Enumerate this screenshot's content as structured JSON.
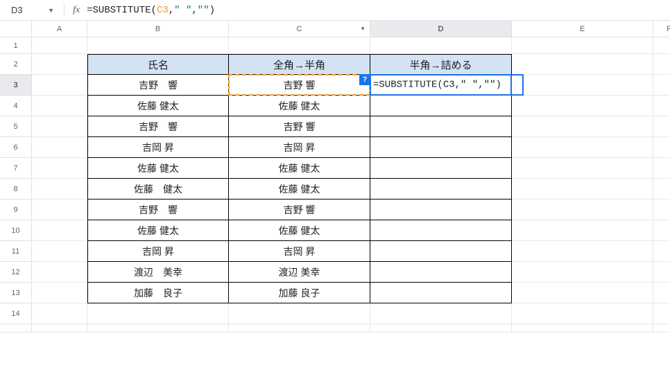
{
  "name_box": "D3",
  "formula_bar": {
    "prefix": "=",
    "fn": "SUBSTITUTE",
    "open": "(",
    "ref": "C3",
    "c1": ",",
    "s1": "\" \"",
    "c2": ",",
    "s2": "\"\"",
    "close": ")"
  },
  "cell_formula": {
    "prefix": "=",
    "fn": "SUBSTITUTE",
    "open": "(",
    "ref": "C3",
    "c1": ",",
    "s1": "\" \"",
    "c2": ",",
    "s2": "\"\"",
    "close": ")"
  },
  "columns": [
    "A",
    "B",
    "C",
    "D",
    "E",
    "F"
  ],
  "col_widths": {
    "A": 80,
    "B": 204,
    "C": 204,
    "D": 204,
    "E": 204,
    "F": 46
  },
  "active_col": "D",
  "row_count": 15,
  "row_height_default": 30,
  "row_height_first": 24,
  "active_row": 3,
  "table": {
    "headers": {
      "B": "氏名",
      "C": "全角→半角",
      "D": "半角→詰める"
    },
    "rows": [
      {
        "B": "吉野　響",
        "C": "吉野 響"
      },
      {
        "B": "佐藤 健太",
        "C": "佐藤 健太"
      },
      {
        "B": "吉野　響",
        "C": "吉野 響"
      },
      {
        "B": "吉岡 昇",
        "C": "吉岡 昇"
      },
      {
        "B": "佐藤 健太",
        "C": "佐藤 健太"
      },
      {
        "B": "佐藤　健太",
        "C": "佐藤 健太"
      },
      {
        "B": "吉野　響",
        "C": "吉野 響"
      },
      {
        "B": "佐藤 健太",
        "C": "佐藤 健太"
      },
      {
        "B": "吉岡 昇",
        "C": "吉岡 昇"
      },
      {
        "B": "渡辺　美幸",
        "C": "渡辺 美幸"
      },
      {
        "B": "加藤　良子",
        "C": "加藤 良子"
      }
    ]
  },
  "help_icon": "?"
}
